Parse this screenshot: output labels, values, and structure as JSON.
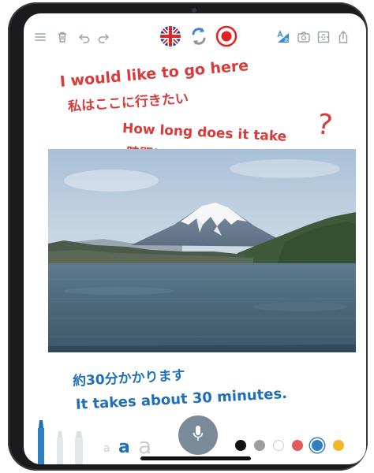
{
  "toolbar": {
    "icons": [
      "menu-icon",
      "trash-icon",
      "undo-icon",
      "redo-icon",
      "uk-flag-icon",
      "swap-icon",
      "record-icon",
      "translate-icon",
      "camera-icon",
      "layout-icon",
      "share-icon"
    ]
  },
  "notes": {
    "line1": "I would like to go here",
    "line2": "私はここに行きたい",
    "line3": "How long does it take",
    "line3_mark": "?",
    "line4": "時間はどのくらいかかる",
    "line5": "約30分かかります",
    "line6": "It takes about 30 minutes."
  },
  "bottom_bar": {
    "size_small": "a",
    "size_medium": "a",
    "size_large": "a",
    "colors": [
      "#111111",
      "#9e9e9e",
      "#ffffff",
      "#e05a5a",
      "#2f7fc4",
      "#f2b62b"
    ],
    "selected_color": "#2f7fc4"
  },
  "colors": {
    "red_ink": "#d93a3a",
    "blue_ink": "#1f6fb4",
    "accent_blue": "#2f7fc4",
    "toolbar_icon": "#9aa3ad"
  }
}
